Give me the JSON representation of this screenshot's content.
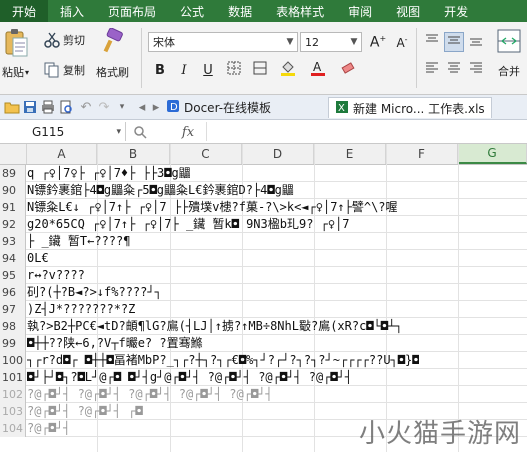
{
  "menu": [
    "开始",
    "插入",
    "页面布局",
    "公式",
    "数据",
    "表格样式",
    "审阅",
    "视图",
    "开发"
  ],
  "ribbon": {
    "paste_label": "粘贴",
    "cut_label": "剪切",
    "copy_label": "复制",
    "format_painter_label": "格式刷",
    "font_name": "宋体",
    "font_size": "12",
    "merge_label": "合并"
  },
  "quickbar": {
    "tab1": "Docer-在线模板",
    "tab2": "新建 Micro... 工作表.xls"
  },
  "formula": {
    "name_box": "G115",
    "fx": "fx"
  },
  "columns": [
    "A",
    "B",
    "C",
    "D",
    "E",
    "F",
    "G"
  ],
  "selected_column": "G",
  "rows": [
    {
      "num": "89",
      "text": "q         ┌♀│7♀├  ┌♀│7♦├ ├├3◘g鼺"
    },
    {
      "num": "90",
      "text": "N镖鈐裹錧├4◘g鼺粂┌5◘g鼺粂L€鈐裹錧D?├4◘g鼺"
    },
    {
      "num": "91",
      "text": "N镖粂L€↓  ┌♀│7↑├  ┌♀│7  ├├殨墣v槵?f菓-?\\>k<◄┌♀│7↑├譬^\\?喔"
    },
    {
      "num": "92",
      "text": "g20*65CQ  ┌♀│7↑├  ┌♀│7├ _鑶 暂k◘  9N3楹b玌9?  ┌♀│7"
    },
    {
      "num": "93",
      "text": "├ _鑶 暂T←????¶"
    },
    {
      "num": "94",
      "text": "0L€"
    },
    {
      "num": "95",
      "text": "r↔?v????"
    },
    {
      "num": "96",
      "text": "矵?(┼?B◄?>↓f%????┘┐"
    },
    {
      "num": "97",
      "text": ")Z┤J*???????*?Z"
    },
    {
      "num": "98",
      "text": "執?>B2┼PC€◄tD?頔¶lG?鳸(┤LJ│↑掳?↑MB÷8NhL斀?鳸(xR?c◘└◘┴┐"
    },
    {
      "num": "99",
      "text": "           ◘┼┼??陕←6,?V┬f曮e? ?置骞鰷"
    },
    {
      "num": "100",
      "text": "┐┌r?d◘┌ ◘┼┼◘畐褚MbP?_┐┌?┼┐?┐┌€◘%┐┘?┌┘?┐?┐?┘~┌┌┌┌??U┐◘}◘"
    },
    {
      "num": "101",
      "text": "◘┘├┘◘┐?◘L┘@┌◘ ◘┘┤g┘@┌◘┘┤ ?@┌◘┘┤  ?@┌◘┘┤  ?@┌◘┘┤"
    },
    {
      "num": "102",
      "text": "           ?@┌◘┘┤  ?@┌◘┘┤  ?@┌◘┘┤ ?@┌◘┘┤  ?@┌◘┘┤"
    },
    {
      "num": "103",
      "text": "           ?@┌◘┘┤  ?@┌◘┘┤ ┌◘"
    },
    {
      "num": "104",
      "text": "           ?@┌◘┘┤"
    }
  ],
  "watermark": "小火猫手游网"
}
